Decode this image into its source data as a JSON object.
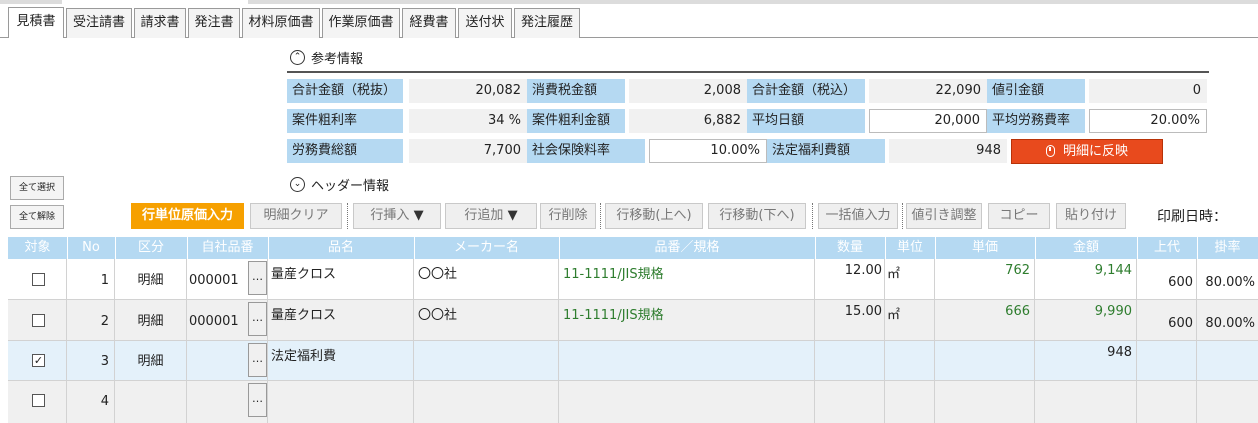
{
  "tabs": [
    "見積書",
    "受注請書",
    "請求書",
    "発注書",
    "材料原価書",
    "作業原価書",
    "経費書",
    "送付状",
    "発注履歴"
  ],
  "reference": {
    "heading": "参考情報",
    "fields": {
      "subtotal_label": "合計金額（税抜）",
      "subtotal": "20,082",
      "tax_label": "消費税金額",
      "tax": "2,008",
      "total_label": "合計金額（税込）",
      "total": "22,090",
      "discount_label": "値引金額",
      "discount": "0",
      "margin_rate_label": "案件粗利率",
      "margin_rate": "34 %",
      "margin_amount_label": "案件粗利金額",
      "margin_amount": "6,882",
      "avg_day_label": "平均日額",
      "avg_day": "20,000",
      "avg_labor_label": "平均労務費率",
      "avg_labor": "20.00%",
      "labor_total_label": "労務費総額",
      "labor_total": "7,700",
      "social_label": "社会保険料率",
      "social": "10.00%",
      "welfare_label": "法定福利費額",
      "welfare": "948"
    },
    "reflect_button": "明細に反映"
  },
  "header_info": {
    "heading": "ヘッダー情報"
  },
  "select_buttons": {
    "select_all": "全て選択",
    "clear_all": "全て解除"
  },
  "toolbar": {
    "row_cost_input": "行単位原価入力",
    "clear": "明細クリア",
    "insert": "行挿入",
    "add": "行追加",
    "delete": "行削除",
    "move_up": "行移動(上へ)",
    "move_down": "行移動(下へ)",
    "bulk": "一括値入力",
    "discount_adjust": "値引き調整",
    "copy": "コピー",
    "paste": "貼り付け",
    "print_date": "印刷日時："
  },
  "table": {
    "columns": [
      "対象",
      "No",
      "区分",
      "自社品番",
      "品名",
      "メーカー名",
      "品番／規格",
      "数量",
      "単位",
      "単価",
      "金額",
      "上代",
      "掛率"
    ],
    "rows": [
      {
        "checked": false,
        "no": "1",
        "kubun": "明細",
        "code": "000001",
        "name": "量産クロス",
        "maker": "〇〇社",
        "spec": "11-1111/JIS規格",
        "qty": "12.00",
        "unit": "㎡",
        "price": "762",
        "amount": "9,144",
        "list": "600",
        "rate": "80.00%"
      },
      {
        "checked": false,
        "no": "2",
        "kubun": "明細",
        "code": "000001",
        "name": "量産クロス",
        "maker": "〇〇社",
        "spec": "11-1111/JIS規格",
        "qty": "15.00",
        "unit": "㎡",
        "price": "666",
        "amount": "9,990",
        "list": "600",
        "rate": "80.00%"
      },
      {
        "checked": true,
        "no": "3",
        "kubun": "明細",
        "code": "",
        "name": "法定福利費",
        "maker": "",
        "spec": "",
        "qty": "",
        "unit": "",
        "price": "",
        "amount": "948",
        "list": "",
        "rate": ""
      },
      {
        "checked": false,
        "no": "4",
        "kubun": "",
        "code": "",
        "name": "",
        "maker": "",
        "spec": "",
        "qty": "",
        "unit": "",
        "price": "",
        "amount": "",
        "list": "",
        "rate": ""
      }
    ]
  }
}
